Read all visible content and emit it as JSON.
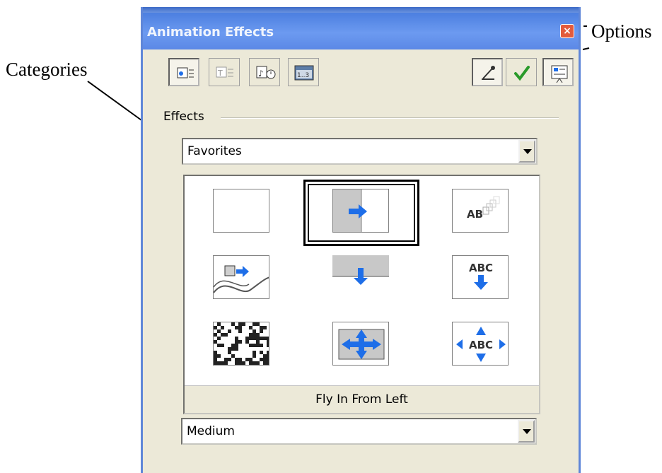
{
  "annotations": {
    "categories": "Categories",
    "options": "Options"
  },
  "window": {
    "title": "Animation Effects",
    "close_glyph": "×"
  },
  "toolbar": {
    "category_icons": [
      "entrance-category-icon",
      "emphasis-category-icon",
      "exit-category-icon",
      "motion-paths-category-icon"
    ],
    "option_icons": [
      "effect-options-icon",
      "apply-icon",
      "preview-icon"
    ]
  },
  "effects": {
    "group_label": "Effects",
    "category_value": "Favorites",
    "selected_effect": "Fly In From Left",
    "speed_value": "Medium",
    "tiles": [
      {
        "icon": "appear-icon",
        "selected": false
      },
      {
        "icon": "fly-in-from-left-icon",
        "selected": true
      },
      {
        "icon": "fade-text-icon",
        "selected": false
      },
      {
        "icon": "curve-path-icon",
        "selected": false
      },
      {
        "icon": "fly-in-from-top-icon",
        "selected": false
      },
      {
        "icon": "text-fly-in-from-top-icon",
        "selected": false
      },
      {
        "icon": "dissolve-icon",
        "selected": false
      },
      {
        "icon": "box-out-icon",
        "selected": false
      },
      {
        "icon": "text-expand-icon",
        "selected": false
      }
    ],
    "tile_text": {
      "fade_text": "AB",
      "text_top": "ABC",
      "text_expand": "ABC"
    }
  },
  "colors": {
    "accent_blue": "#1e6ee8",
    "title_bar": "#5b88e6",
    "dialog_face": "#ece9d8"
  }
}
